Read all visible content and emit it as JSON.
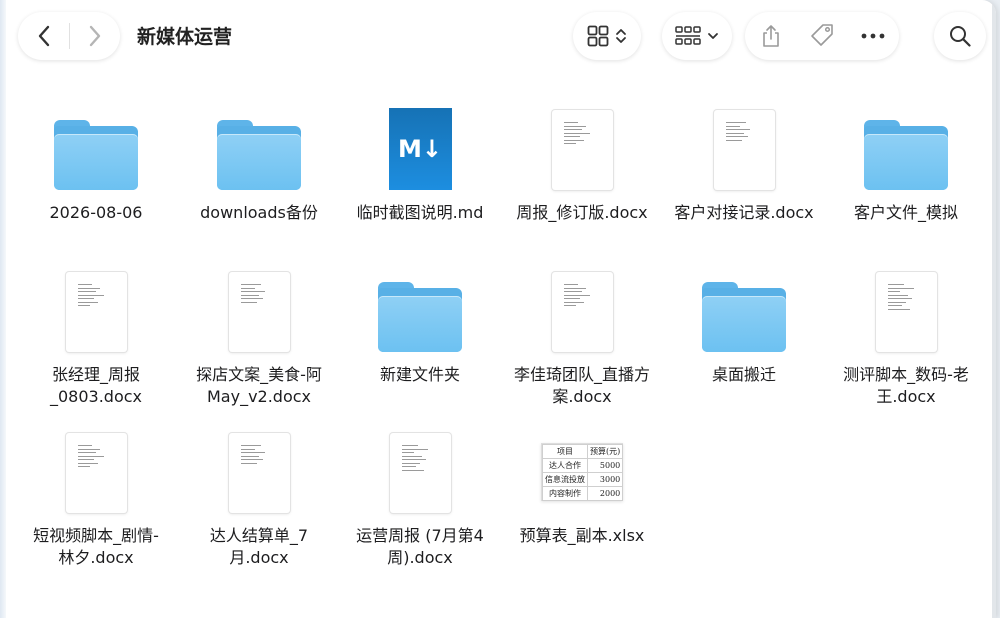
{
  "window": {
    "title": "新媒体运营"
  },
  "toolbar": {
    "back_icon": "chevron-left-icon",
    "forward_icon": "chevron-right-icon",
    "view_icon": "grid-view-icon",
    "group_icon": "group-by-icon",
    "share_icon": "share-icon",
    "tag_icon": "tag-icon",
    "more_icon": "ellipsis-icon",
    "search_icon": "search-icon"
  },
  "files": [
    {
      "name": "2026-08-06",
      "kind": "folder"
    },
    {
      "name": "downloads备份",
      "kind": "folder"
    },
    {
      "name": "临时截图说明.md",
      "kind": "markdown",
      "badge": "M↓"
    },
    {
      "name": "周报_修订版.docx",
      "kind": "doc"
    },
    {
      "name": "客户对接记录.docx",
      "kind": "doc"
    },
    {
      "name": "客户文件_模拟",
      "kind": "folder"
    },
    {
      "name": "张经理_周报_0803.docx",
      "kind": "doc",
      "lines": [
        "张经理_周报",
        "_0803.docx"
      ]
    },
    {
      "name": "探店文案_美食-阿May_v2.docx",
      "kind": "doc",
      "lines": [
        "探店文案_美食-阿",
        "May_v2.docx"
      ]
    },
    {
      "name": "新建文件夹",
      "kind": "folder"
    },
    {
      "name": "李佳琦团队_直播方案.docx",
      "kind": "doc",
      "lines": [
        "李佳琦团队_直播方",
        "案.docx"
      ]
    },
    {
      "name": "桌面搬迁",
      "kind": "folder"
    },
    {
      "name": "测评脚本_数码-老王.docx",
      "kind": "doc",
      "lines": [
        "测评脚本_数码-老",
        "王.docx"
      ]
    },
    {
      "name": "短视频脚本_剧情-林夕.docx",
      "kind": "doc",
      "lines": [
        "短视频脚本_剧情-",
        "林夕.docx"
      ]
    },
    {
      "name": "达人结算单_7月.docx",
      "kind": "doc",
      "lines": [
        "达人结算单_7",
        "月.docx"
      ]
    },
    {
      "name": "运营周报 (7月第4周).docx",
      "kind": "doc",
      "lines": [
        "运营周报 (7月第4",
        "周).docx"
      ]
    },
    {
      "name": "预算表_副本.xlsx",
      "kind": "xlsx"
    }
  ],
  "xlsx_preview": {
    "rows": [
      [
        "项目",
        "预算(元)"
      ],
      [
        "达人合作",
        "5000"
      ],
      [
        "信息流投放",
        "3000"
      ],
      [
        "内容制作",
        "2000"
      ]
    ]
  },
  "colors": {
    "folder": "#6cc1f1",
    "markdown": "#1d8ee0",
    "background": "#ffffff"
  }
}
